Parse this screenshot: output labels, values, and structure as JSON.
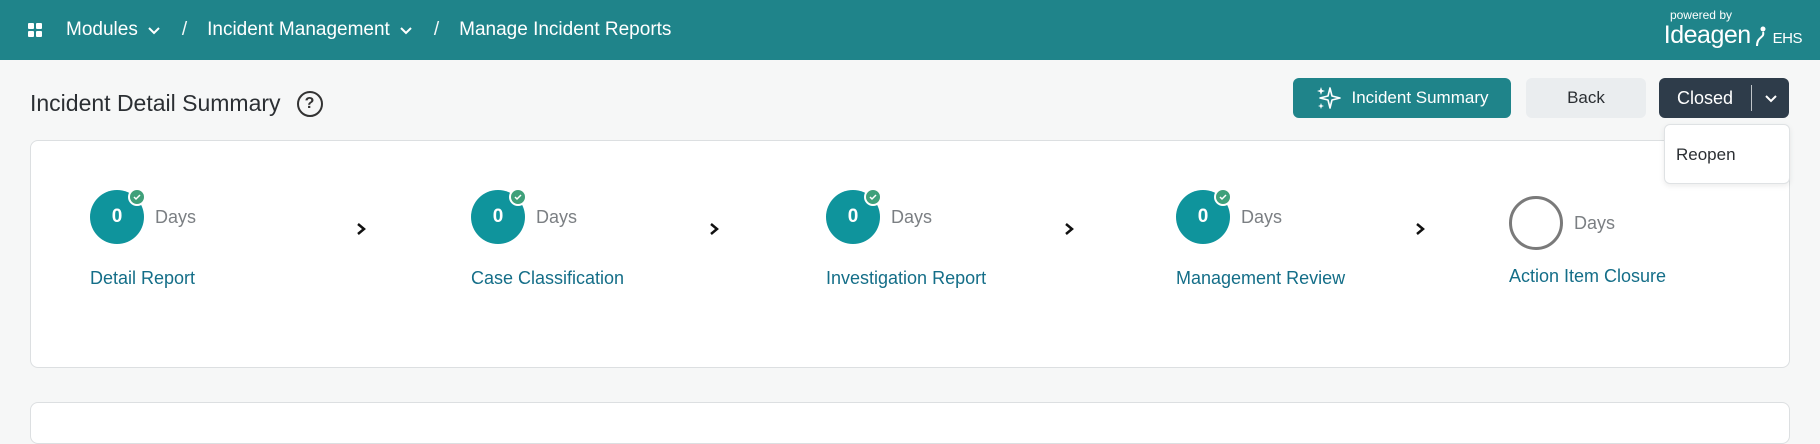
{
  "breadcrumb": {
    "modules": "Modules",
    "incident_management": "Incident Management",
    "current": "Manage Incident Reports",
    "separator": "/"
  },
  "brand": {
    "powered_by": "powered by",
    "logo": "Ideagen",
    "suffix": "EHS"
  },
  "page": {
    "title": "Incident Detail Summary",
    "help": "?"
  },
  "buttons": {
    "summary": "Incident Summary",
    "back": "Back",
    "status": "Closed"
  },
  "status_menu": {
    "options": [
      "Reopen"
    ]
  },
  "stages": [
    {
      "name": "Detail Report",
      "days": "0",
      "unit": "Days",
      "complete": true
    },
    {
      "name": "Case Classification",
      "days": "0",
      "unit": "Days",
      "complete": true
    },
    {
      "name": "Investigation Report",
      "days": "0",
      "unit": "Days",
      "complete": true
    },
    {
      "name": "Management Review",
      "days": "0",
      "unit": "Days",
      "complete": true
    },
    {
      "name": "Action Item Closure",
      "days": "",
      "unit": "Days",
      "complete": false
    }
  ],
  "colors": {
    "brand": "#1f848a",
    "progress": "#0f949c",
    "status_button": "#2e3c4a",
    "check": "#3fa07a",
    "link": "#146e88"
  }
}
